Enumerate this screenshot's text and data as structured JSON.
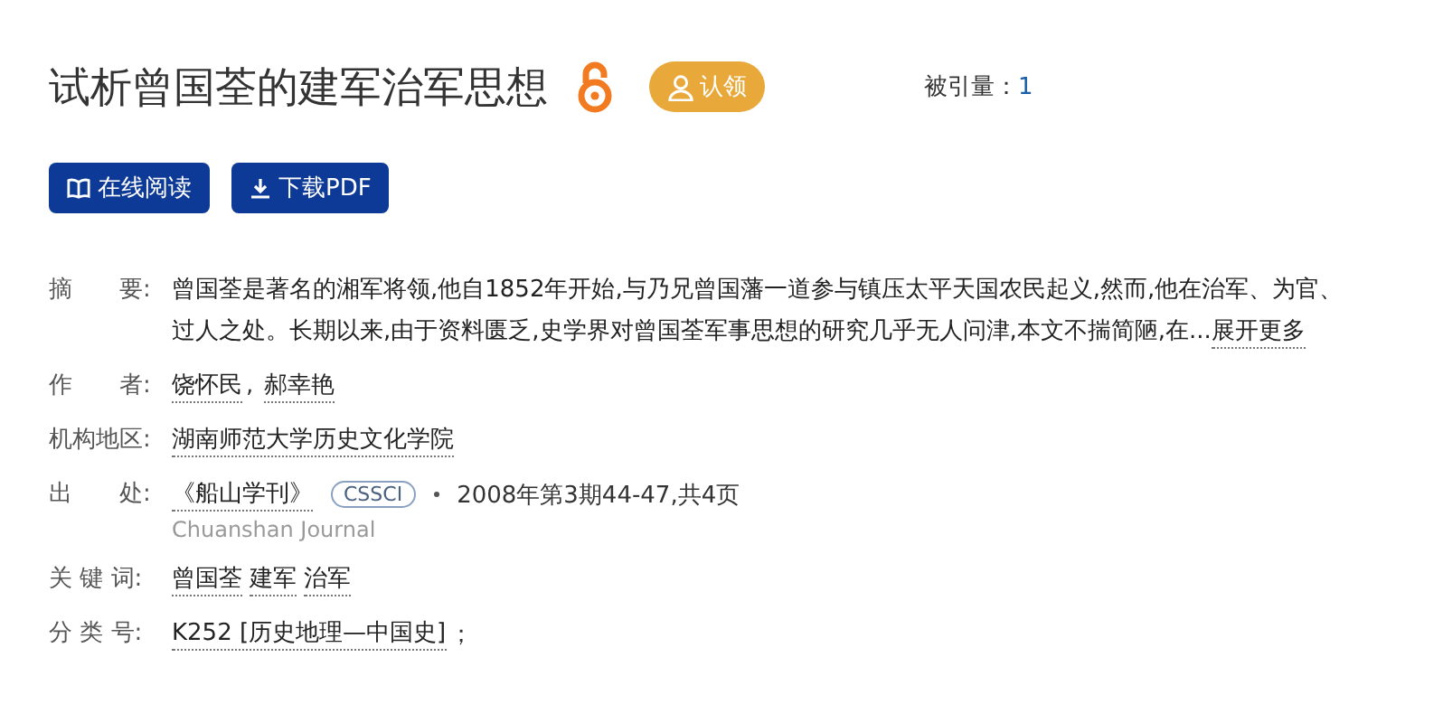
{
  "title": "试析曾国荃的建军治军思想",
  "claim_badge": "认领",
  "citations": {
    "label": "被引量：",
    "value": "1"
  },
  "buttons": [
    {
      "kind": "read",
      "label": "在线阅读"
    },
    {
      "kind": "download",
      "label": "下载PDF"
    }
  ],
  "abstract": {
    "label": "摘　　要:",
    "lines": [
      "曾国荃是著名的湘军将领,他自1852年开始,与乃兄曾国藩一道参与镇压太平天国农民起义,然而,他在治军、为官、",
      "过人之处。长期以来,由于资料匮乏,史学界对曾国荃军事思想的研究几乎无人问津,本文不揣简陋,在..."
    ],
    "more": "展开更多"
  },
  "authors": {
    "label": "作　　者:",
    "names": [
      "饶怀民",
      "郝幸艳"
    ],
    "separator": ","
  },
  "institution": {
    "label": "机构地区:",
    "value": "湖南师范大学历史文化学院"
  },
  "source": {
    "label": "出　　处:",
    "journal": "《船山学刊》",
    "tag": "CSSCI",
    "issue": "2008年第3期44-47,共4页",
    "journal_en": "Chuanshan Journal"
  },
  "keywords": {
    "label": "关 键 词:",
    "items": [
      "曾国荃",
      "建军",
      "治军"
    ]
  },
  "classification": {
    "label": "分 类 号:",
    "value": "K252 [历史地理—中国史]",
    "suffix": "；"
  }
}
